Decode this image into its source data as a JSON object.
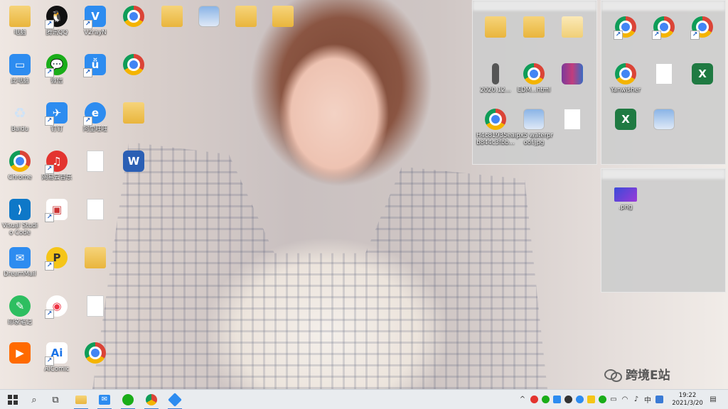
{
  "desktop": {
    "left_icons": [
      {
        "label": "电脑",
        "glyph": "folder"
      },
      {
        "label": "腾讯QQ",
        "glyph": "qq"
      },
      {
        "label": "V2rayN",
        "glyph": "v2ray"
      },
      {
        "label": "",
        "glyph": "chrome"
      },
      {
        "label": "",
        "glyph": "folder"
      },
      {
        "label": "",
        "glyph": "imgfile"
      },
      {
        "label": "",
        "glyph": "folder"
      },
      {
        "label": "",
        "glyph": "folder"
      },
      {
        "label": "此电脑",
        "glyph": "pc"
      },
      {
        "label": "微信",
        "glyph": "wechat"
      },
      {
        "label": "",
        "glyph": "tool"
      },
      {
        "label": "",
        "glyph": "chrome"
      },
      {
        "label": "Baidu",
        "glyph": "recycle"
      },
      {
        "label": "钉钉",
        "glyph": "dingtalk"
      },
      {
        "label": "阿里旺旺",
        "glyph": "aliww"
      },
      {
        "label": "",
        "glyph": "folder"
      },
      {
        "label": "Chrome",
        "glyph": "chrome"
      },
      {
        "label": "网易云音乐",
        "glyph": "netease"
      },
      {
        "label": "",
        "glyph": "doc"
      },
      {
        "label": "",
        "glyph": "docx"
      },
      {
        "label": "Visual Studio Code",
        "glyph": "vscode"
      },
      {
        "label": "",
        "glyph": "tool2"
      },
      {
        "label": "",
        "glyph": "doc"
      },
      {
        "label": "DreamMail",
        "glyph": "mail"
      },
      {
        "label": "",
        "glyph": "pp"
      },
      {
        "label": "",
        "glyph": "folder"
      },
      {
        "label": "印象笔记",
        "glyph": "evernote"
      },
      {
        "label": "",
        "glyph": "music"
      },
      {
        "label": "",
        "glyph": "doc"
      },
      {
        "label": "",
        "glyph": "video"
      },
      {
        "label": "AiComic",
        "glyph": "ai"
      },
      {
        "label": "",
        "glyph": "chrome"
      }
    ]
  },
  "fence_a": {
    "title": "",
    "items": [
      {
        "label": "",
        "glyph": "folder"
      },
      {
        "label": "",
        "glyph": "folder"
      },
      {
        "label": "",
        "glyph": "doc"
      },
      {
        "label": "2020.12...",
        "glyph": "doc"
      },
      {
        "label": "EDM...html",
        "glyph": "chrome"
      },
      {
        "label": "",
        "glyph": "winrar"
      },
      {
        "label": "H4c81935ea b844c3fbb...",
        "glyph": "chrome"
      },
      {
        "label": "ipx5 waterpr oof.jpg",
        "glyph": "imgfile"
      },
      {
        "label": "",
        "glyph": "doc"
      }
    ]
  },
  "fence_b": {
    "title": "",
    "items": [
      {
        "label": "",
        "glyph": "chrome"
      },
      {
        "label": "",
        "glyph": "chrome"
      },
      {
        "label": "",
        "glyph": "chrome"
      },
      {
        "label": "Yanwisher",
        "glyph": "chrome"
      },
      {
        "label": "",
        "glyph": "doc"
      },
      {
        "label": "",
        "glyph": "xls"
      },
      {
        "label": "",
        "glyph": "xls"
      },
      {
        "label": "",
        "glyph": "imgfile"
      }
    ]
  },
  "fence_c": {
    "title": "",
    "items": [
      {
        "label": ".png",
        "glyph": "purple"
      }
    ]
  },
  "taskbar": {
    "apps": [
      "start-icon",
      "search-icon",
      "task-view-icon",
      "file-explorer-icon",
      "mail-icon",
      "wechat-icon",
      "chrome-icon",
      "feishu-icon"
    ],
    "clock_time": "19:22",
    "clock_date": "2021/3/20"
  },
  "watermark": {
    "text": "跨境E站"
  }
}
